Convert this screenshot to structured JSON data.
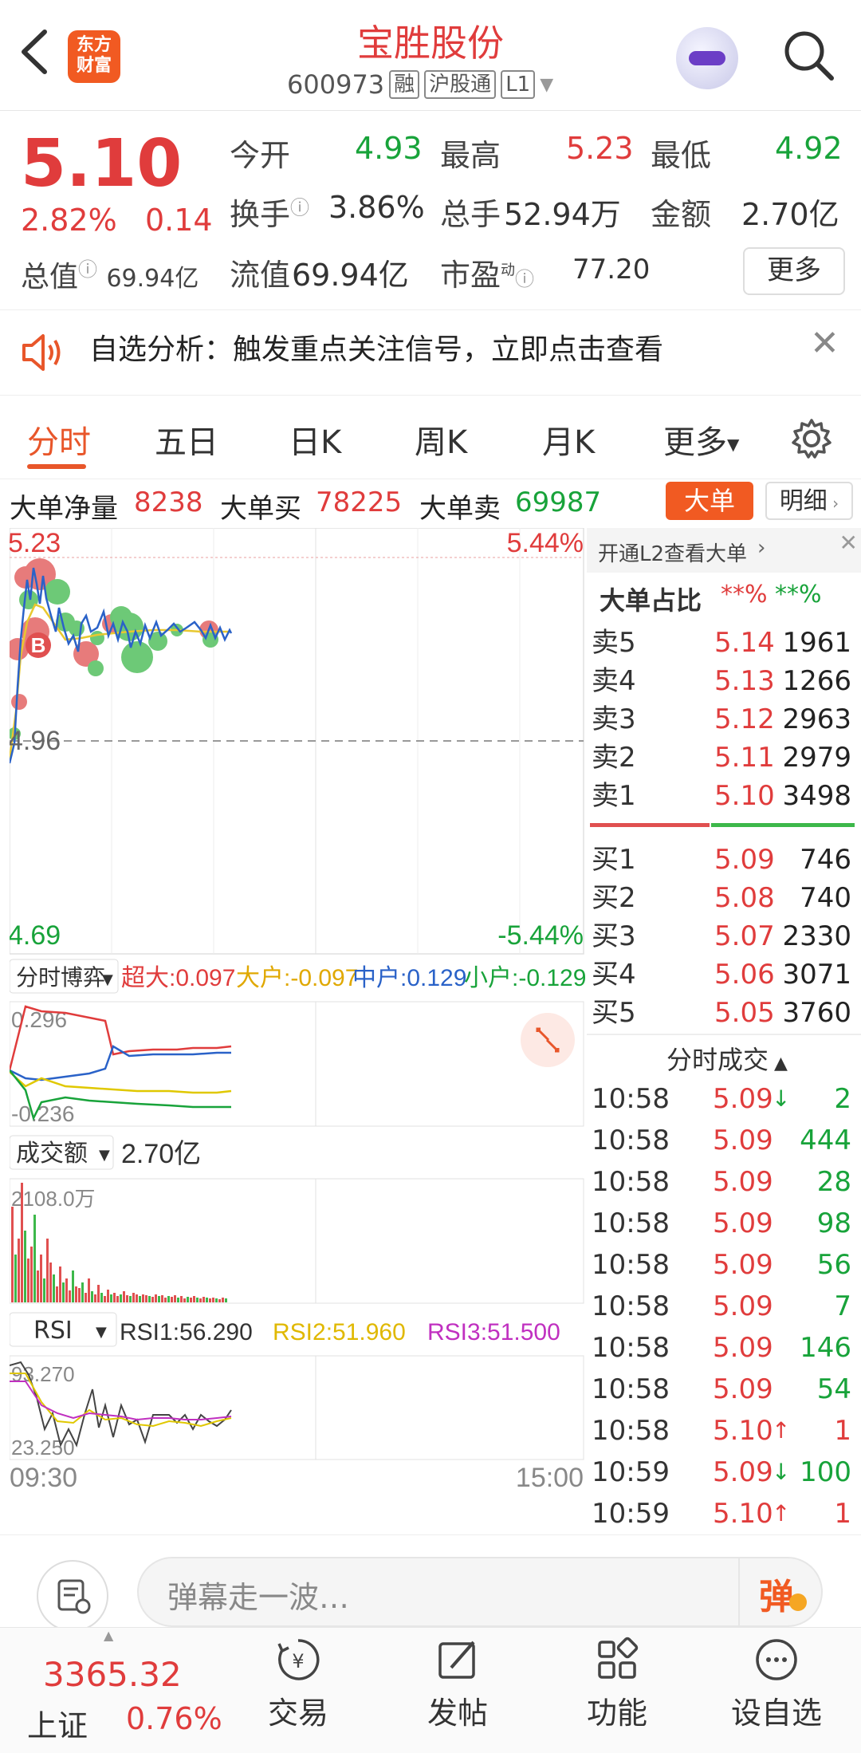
{
  "header": {
    "back_icon": "back-arrow-icon",
    "logo_text": "东方财富",
    "stock_name": "宝胜股份",
    "stock_code": "600973",
    "tags": [
      "融",
      "沪股通",
      "L1"
    ],
    "search_icon": "search-icon"
  },
  "quote": {
    "price": "5.10",
    "change_pct": "2.82%",
    "change_amt": "0.14",
    "total_value_label": "总值",
    "total_value": "69.94亿",
    "open_label": "今开",
    "open": "4.93",
    "high_label": "最高",
    "high": "5.23",
    "low_label": "最低",
    "low": "4.92",
    "turnover_label": "换手",
    "turnover": "3.86%",
    "volume_label": "总手",
    "volume": "52.94万",
    "amount_label": "金额",
    "amount": "2.70亿",
    "float_label": "流值",
    "float_value": "69.94亿",
    "pe_label": "市盈",
    "pe_sup": "动",
    "pe": "77.20",
    "more_label": "更多"
  },
  "notice": {
    "text": "自选分析：触发重点关注信号，立即点击查看"
  },
  "tabs": [
    "分时",
    "五日",
    "日K",
    "周K",
    "月K",
    "更多"
  ],
  "big_order": {
    "net_label": "大单净量",
    "net": "8238",
    "buy_label": "大单买",
    "buy": "78225",
    "sell_label": "大单卖",
    "sell": "69987",
    "dadan_btn": "大单",
    "mingxi_btn": "明细"
  },
  "chart": {
    "price_high": "5.23",
    "price_mid": "4.96",
    "price_low": "4.69",
    "pct_high": "5.44%",
    "pct_low": "-5.44%",
    "b_marker": "B",
    "bobo_label": "分时博弈",
    "bobo_items": [
      {
        "label": "超大:0.097",
        "color": "#e03c3c"
      },
      {
        "label": "大户:-0.097",
        "color": "#e0a800"
      },
      {
        "label": "中户:0.129",
        "color": "#2a62c8"
      },
      {
        "label": "小户:-0.129",
        "color": "#18a33a"
      }
    ],
    "bobo_top": "0.296",
    "bobo_bottom": "-0.236",
    "amount_label": "成交额",
    "amount_value": "2.70亿",
    "amount_top": "2108.0万",
    "rsi_label": "RSI",
    "rsi_items": [
      {
        "label": "RSI1:56.290",
        "color": "#333333"
      },
      {
        "label": "RSI2:51.960",
        "color": "#e0b800"
      },
      {
        "label": "RSI3:51.500",
        "color": "#c030c0"
      }
    ],
    "rsi_top": "93.270",
    "rsi_bottom": "23.250",
    "time_start": "09:30",
    "time_end": "15:00"
  },
  "order_book": {
    "l2_link": "开通L2查看大单",
    "ratio_label": "大单占比",
    "ratio_red": "**%",
    "ratio_green": "**%",
    "asks": [
      {
        "label": "卖5",
        "price": "5.14",
        "vol": "1961"
      },
      {
        "label": "卖4",
        "price": "5.13",
        "vol": "1266"
      },
      {
        "label": "卖3",
        "price": "5.12",
        "vol": "2963"
      },
      {
        "label": "卖2",
        "price": "5.11",
        "vol": "2979"
      },
      {
        "label": "卖1",
        "price": "5.10",
        "vol": "3498"
      }
    ],
    "bids": [
      {
        "label": "买1",
        "price": "5.09",
        "vol": "746"
      },
      {
        "label": "买2",
        "price": "5.08",
        "vol": "740"
      },
      {
        "label": "买3",
        "price": "5.07",
        "vol": "2330"
      },
      {
        "label": "买4",
        "price": "5.06",
        "vol": "3071"
      },
      {
        "label": "买5",
        "price": "5.05",
        "vol": "3760"
      }
    ],
    "trades_label": "分时成交",
    "trades": [
      {
        "time": "10:58",
        "price": "5.09",
        "dir": "↓",
        "vol": "2",
        "side": "sell"
      },
      {
        "time": "10:58",
        "price": "5.09",
        "dir": "",
        "vol": "444",
        "side": "sell"
      },
      {
        "time": "10:58",
        "price": "5.09",
        "dir": "",
        "vol": "28",
        "side": "sell"
      },
      {
        "time": "10:58",
        "price": "5.09",
        "dir": "",
        "vol": "98",
        "side": "sell"
      },
      {
        "time": "10:58",
        "price": "5.09",
        "dir": "",
        "vol": "56",
        "side": "sell"
      },
      {
        "time": "10:58",
        "price": "5.09",
        "dir": "",
        "vol": "7",
        "side": "sell"
      },
      {
        "time": "10:58",
        "price": "5.09",
        "dir": "",
        "vol": "146",
        "side": "sell"
      },
      {
        "time": "10:58",
        "price": "5.09",
        "dir": "",
        "vol": "54",
        "side": "sell"
      },
      {
        "time": "10:58",
        "price": "5.10",
        "dir": "↑",
        "vol": "1",
        "side": "buy"
      },
      {
        "time": "10:59",
        "price": "5.09",
        "dir": "↓",
        "vol": "100",
        "side": "sell"
      },
      {
        "time": "10:59",
        "price": "5.10",
        "dir": "↑",
        "vol": "1",
        "side": "buy"
      }
    ]
  },
  "danmu": {
    "placeholder": "弹幕走一波…",
    "send_label": "弹"
  },
  "bottom_nav": {
    "index_value": "3365.32",
    "index_name": "上证",
    "index_pct": "0.76%",
    "items": [
      {
        "label": "交易",
        "icon": "trade-icon"
      },
      {
        "label": "发帖",
        "icon": "post-icon"
      },
      {
        "label": "功能",
        "icon": "grid-icon"
      },
      {
        "label": "设自选",
        "icon": "more-dots-icon"
      }
    ]
  },
  "colors": {
    "up": "#e03c3c",
    "down": "#18a33a",
    "accent": "#e8562a"
  }
}
